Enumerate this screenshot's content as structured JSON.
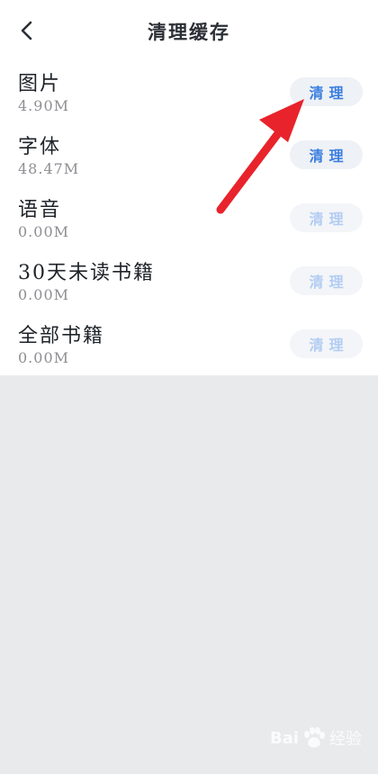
{
  "header": {
    "title": "清理缓存",
    "back_icon": "chevron-left-icon"
  },
  "items": [
    {
      "name": "图片",
      "size": "4.90M",
      "button": "清理",
      "enabled": true
    },
    {
      "name": "字体",
      "size": "48.47M",
      "button": "清理",
      "enabled": true
    },
    {
      "name": "语音",
      "size": "0.00M",
      "button": "清理",
      "enabled": false
    },
    {
      "name": "30天未读书籍",
      "size": "0.00M",
      "button": "清理",
      "enabled": false
    },
    {
      "name": "全部书籍",
      "size": "0.00M",
      "button": "清理",
      "enabled": false
    }
  ],
  "watermark": {
    "text_left": "Bai",
    "text_right": "经验"
  },
  "colors": {
    "accent": "#3b7fe0",
    "accent_disabled": "#b3cdf3",
    "arrow": "#e8232b",
    "background": "#e9eaec"
  }
}
